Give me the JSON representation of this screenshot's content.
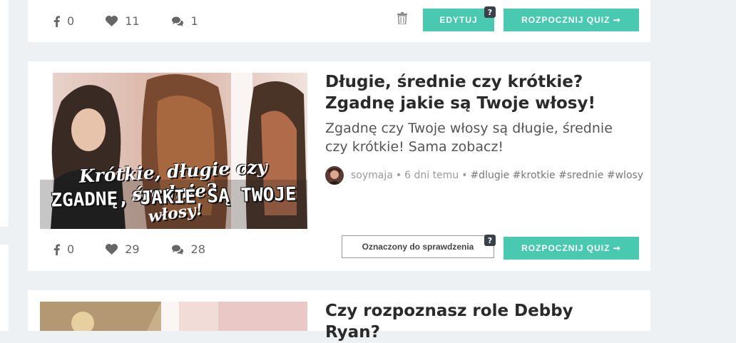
{
  "colors": {
    "accent": "#49c9b0",
    "background": "#eef1f4",
    "card": "#ffffff"
  },
  "quizzes": [
    {
      "stats": {
        "facebook": "0",
        "likes": "11",
        "comments": "1"
      },
      "buttons": {
        "edit": "EDYTUJ",
        "start": "ROZPOCZNIJ QUIZ ➞",
        "badge": "?"
      }
    },
    {
      "title": "Długie, średnie czy krótkie? Zgadnę jakie są Twoje włosy!",
      "description": "Zgadnę czy Twoje włosy są długie, średnie czy krótkie! Sama zobacz!",
      "author": "soymaja",
      "separator": "•",
      "time": "6 dni temu",
      "tags": "#dlugie #krotkie #srednie #wlosy",
      "thumb_text_line1": "Krótkie, długie czy średnie?",
      "thumb_text_line2": "ZGADNĘ, JAKIE SĄ TWOJE",
      "thumb_text_line3": "włosy!",
      "stats": {
        "facebook": "0",
        "likes": "29",
        "comments": "28"
      },
      "buttons": {
        "flagged": "Oznaczony do sprawdzenia",
        "start": "ROZPOCZNIJ QUIZ ➞",
        "badge": "?"
      }
    },
    {
      "title": "Czy rozpoznasz role Debby Ryan?"
    }
  ]
}
